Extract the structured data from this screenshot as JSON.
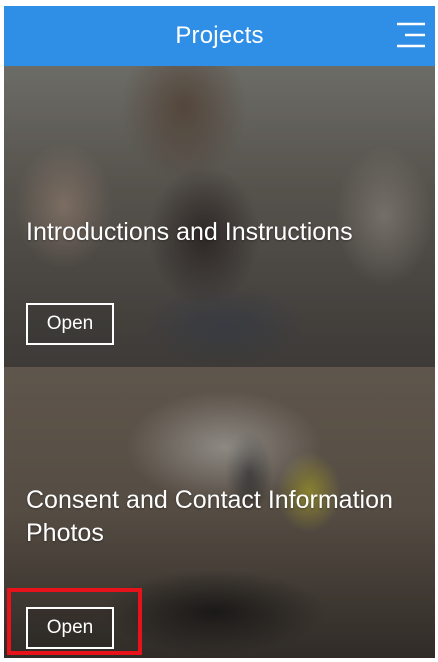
{
  "header": {
    "title": "Projects",
    "menu_icon": "hamburger-menu-icon",
    "background_color": "#2f8fe6"
  },
  "projects": [
    {
      "title": "Introductions and Instructions",
      "open_label": "Open",
      "image": "photo of mother with babies"
    },
    {
      "title": "Consent and Contact Information Photos",
      "open_label": "Open",
      "image": "photo of hands with phone on desk"
    }
  ],
  "highlight": {
    "target": "second project Open button",
    "color": "#e8121a"
  }
}
